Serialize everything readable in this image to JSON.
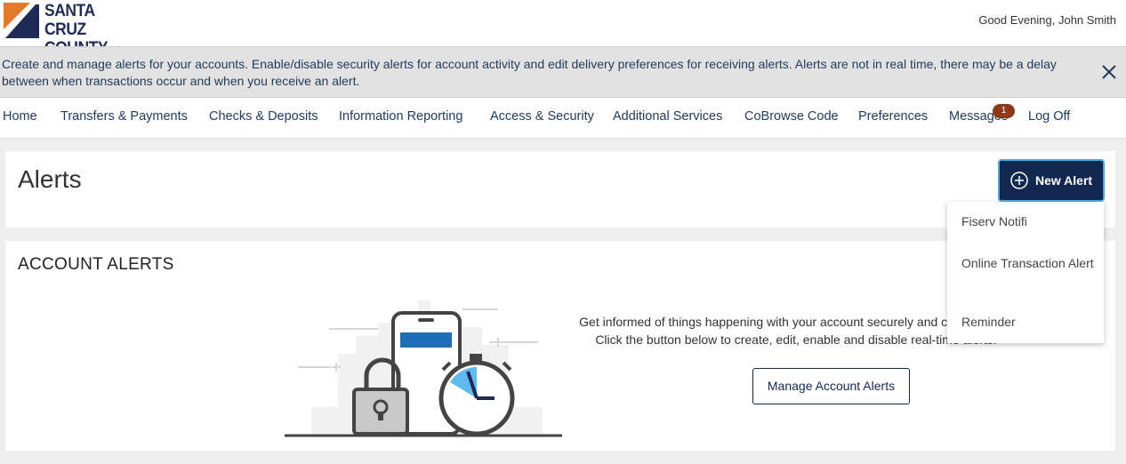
{
  "bank": {
    "logo_line1": "SANTA CRUZ",
    "logo_line2": "COUNTY BANK",
    "brand_navy": "#1f2a55",
    "brand_orange": "#e07a2e"
  },
  "header": {
    "greeting": "Good Evening, John Smith"
  },
  "banner": {
    "text": "Create and manage alerts for your accounts. Enable/disable security alerts for account activity and edit delivery preferences for receiving alerts. Alerts are not in real time, there may be a delay between when transactions occur and when you receive an alert.",
    "close_icon": "close-icon"
  },
  "nav": {
    "items": [
      "Home",
      "Transfers & Payments",
      "Checks & Deposits",
      "Information Reporting",
      "Access & Security",
      "Additional Services",
      "CoBrowse Code",
      "Preferences",
      "Messages",
      "Log Off"
    ],
    "messages_badge": "1"
  },
  "page": {
    "title": "Alerts",
    "new_alert_label": "New Alert",
    "new_alert_icon": "plus-circle-icon"
  },
  "dropdown": {
    "items": [
      "Fiserv Notifi",
      "Online Transaction Alert",
      "Reminder"
    ]
  },
  "account_alerts": {
    "title": "ACCOUNT ALERTS",
    "description": "Get informed of things happening with your account securely and conveniently. Click the button below to create, edit, enable and disable real-time alerts.",
    "manage_label": "Manage Account Alerts"
  },
  "colors": {
    "primary_button": "#13284f",
    "focus_ring": "#4aa9d9",
    "badge": "#8b3a1a",
    "nav_text": "#1f3a5a"
  }
}
